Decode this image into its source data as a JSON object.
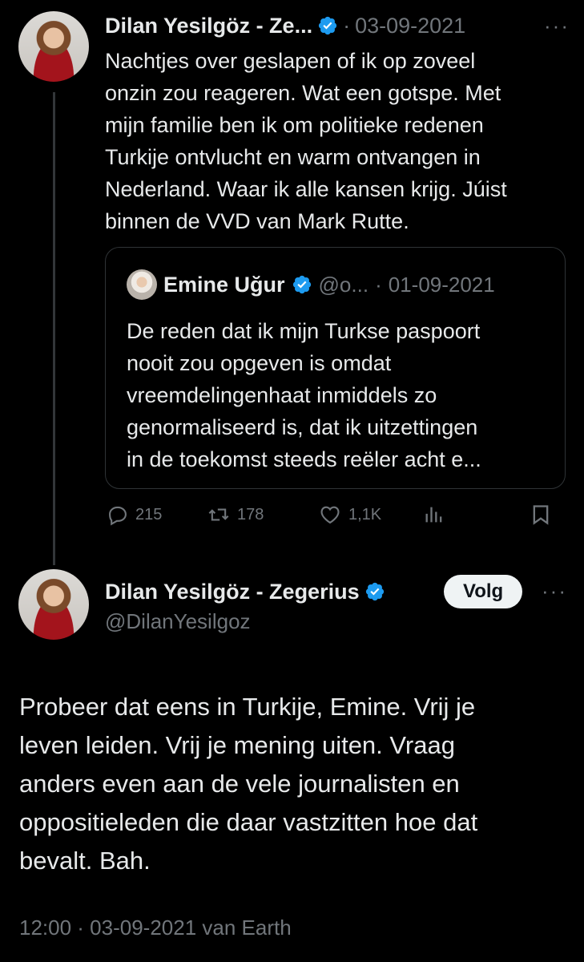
{
  "tweet1": {
    "name": "Dilan Yesilgöz - Ze...",
    "separator": "·",
    "date": "03-09-2021",
    "more": "···",
    "text_lines": [
      "Nachtjes over geslapen of ik op zoveel",
      "onzin zou reageren. Wat een gotspe. Met",
      "mijn familie ben ik om politieke redenen",
      "Turkije ontvlucht en warm ontvangen in",
      "Nederland. Waar ik alle kansen krijg. Júist",
      "binnen de VVD van Mark Rutte."
    ]
  },
  "quote": {
    "name": "Emine Uğur",
    "handle": "@o...",
    "separator": "·",
    "date": "01-09-2021",
    "text_lines": [
      "De reden dat ik mijn Turkse paspoort",
      "nooit zou opgeven is omdat",
      "vreemdelingenhaat inmiddels zo",
      "genormaliseerd is, dat ik uitzettingen",
      "in de toekomst steeds reëler acht e..."
    ]
  },
  "actions": {
    "replies": "215",
    "retweets": "178",
    "likes": "1,1K"
  },
  "tweet2": {
    "name": "Dilan Yesilgöz - Zegerius",
    "handle": "@DilanYesilgoz",
    "follow_label": "Volg",
    "more": "···",
    "text_lines": [
      "Probeer dat eens in Turkije, Emine. Vrij je",
      "leven leiden. Vrij je mening uiten. Vraag",
      "anders even aan de vele journalisten en",
      "oppositieleden die daar vastzitten hoe dat",
      "bevalt. Bah."
    ],
    "timestamp": "12:00 · 03-09-2021 van Earth"
  },
  "colors": {
    "background": "#000000",
    "text": "#e7e9ea",
    "muted": "#71767b",
    "verified": "#1d9bf0",
    "border": "#2f3336"
  }
}
